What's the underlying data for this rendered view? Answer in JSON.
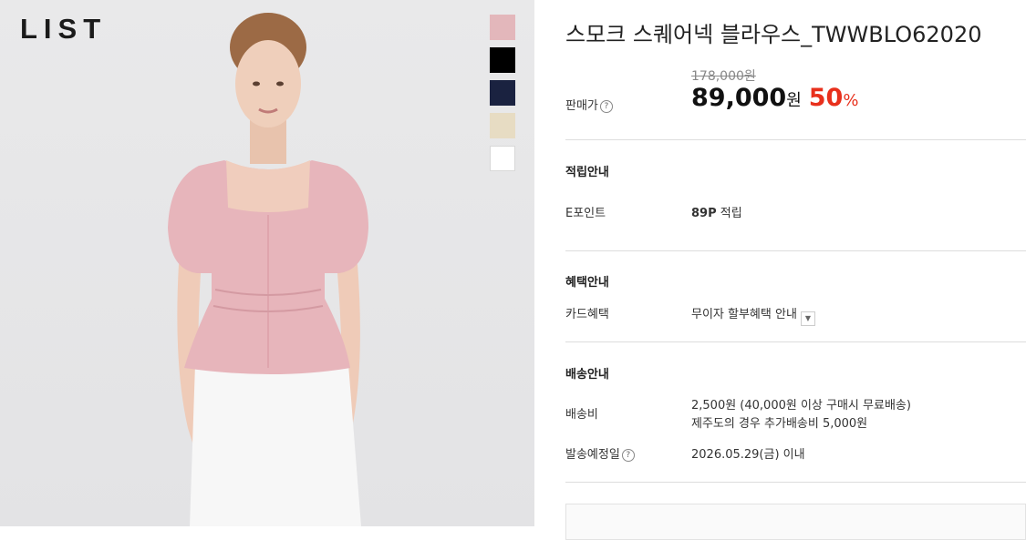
{
  "brand": {
    "logo": "LIST"
  },
  "colors": {
    "swatches": [
      "#e3b7bb",
      "#000000",
      "#1a2240",
      "#e7dcc3",
      "#ffffff"
    ],
    "sale": "#e8301c",
    "background_photo": "#e6e6e8"
  },
  "product": {
    "title": "스모크 스퀘어넥 블라우스_TWWBLO62020",
    "original_price": "178,000원",
    "price_label": "판매가",
    "sale_price": "89,000",
    "currency": "원",
    "discount": "50",
    "discount_unit": "%"
  },
  "points": {
    "heading": "적립안내",
    "label": "E포인트",
    "value_bold": "89P",
    "value_suffix": "적립"
  },
  "benefits": {
    "heading": "혜택안내",
    "label": "카드혜택",
    "value": "무이자 할부혜택 안내",
    "dropdown_icon": "triangle-down"
  },
  "shipping": {
    "heading": "배송안내",
    "fee_label": "배송비",
    "fee_line1": "2,500원 (40,000원 이상 구매시 무료배송)",
    "fee_line2": "제주도의 경우 추가배송비 5,000원",
    "date_label": "발송예정일",
    "date_value": "2026.05.29(금) 이내"
  },
  "help_icon_glyph": "?"
}
